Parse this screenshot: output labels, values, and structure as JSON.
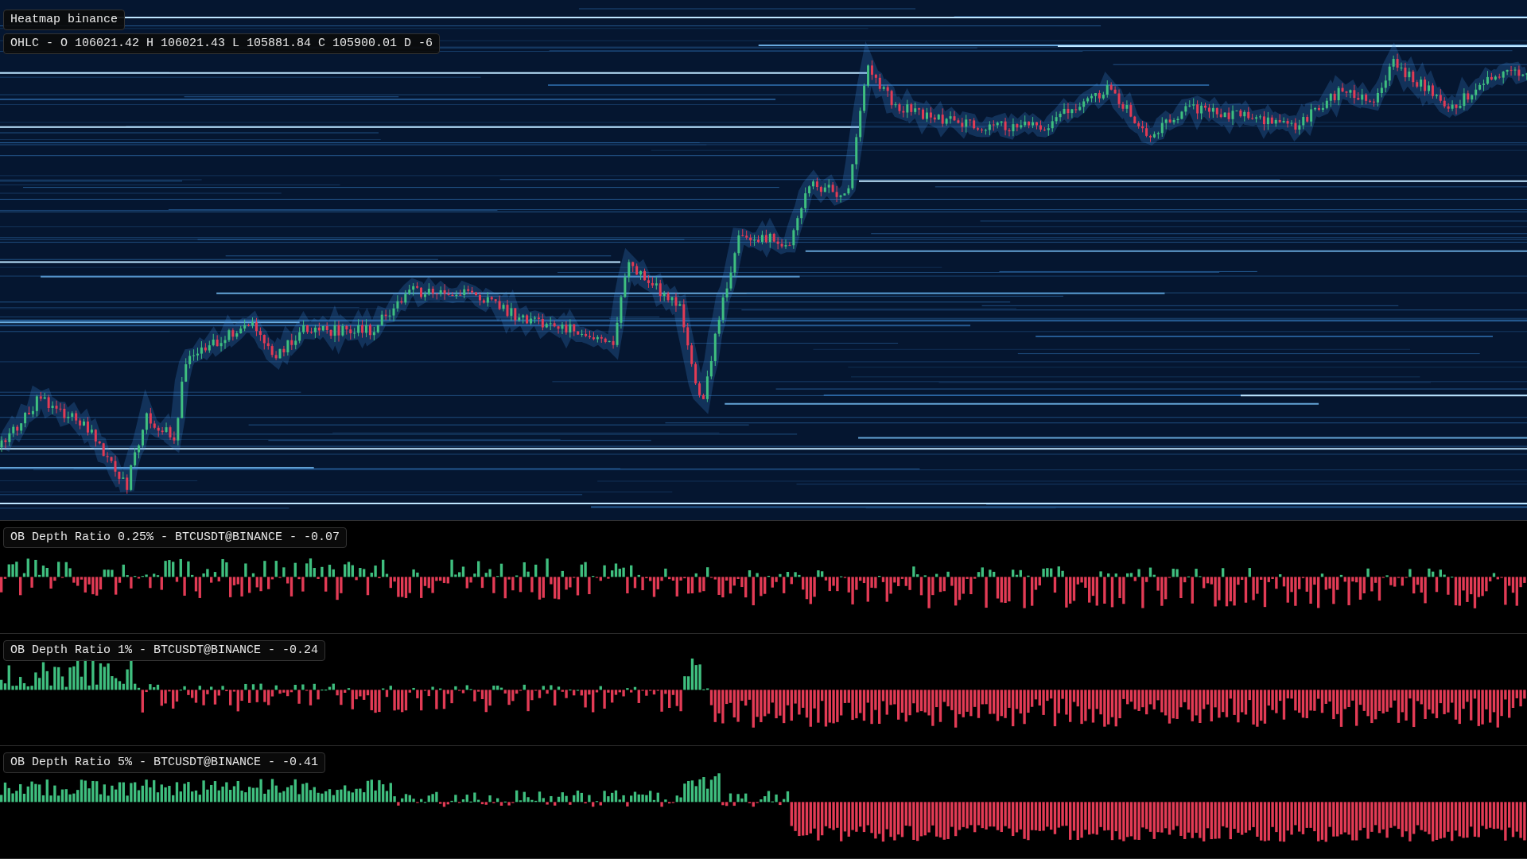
{
  "heatmap": {
    "title": "Heatmap binance",
    "ohlc": "OHLC - O 106021.42 H 106021.43 L 105881.84 C 105900.01 D -6"
  },
  "indicators": [
    {
      "label": "OB Depth Ratio 0.25% - BTCUSDT@BINANCE - -0.07"
    },
    {
      "label": "OB Depth Ratio 1% - BTCUSDT@BINANCE - -0.24"
    },
    {
      "label": "OB Depth Ratio 5% - BTCUSDT@BINANCE - -0.41"
    }
  ]
}
